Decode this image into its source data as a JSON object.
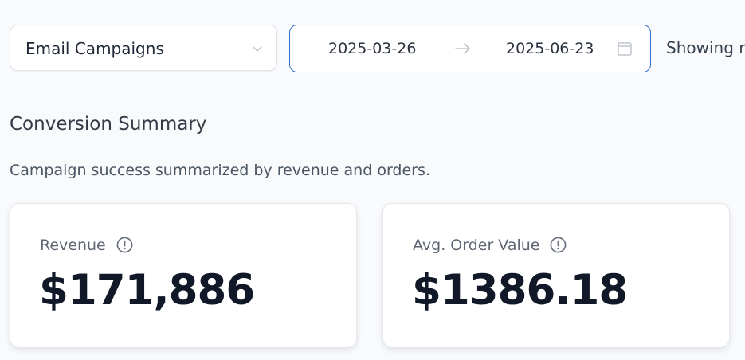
{
  "filters": {
    "campaign_select": {
      "selected": "Email Campaigns",
      "icon": "chevron-down-icon"
    },
    "date_range": {
      "start": "2025-03-26",
      "end": "2025-06-23",
      "separator_icon": "arrow-right-icon",
      "calendar_icon": "calendar-icon",
      "accent_color": "#2f6fc9"
    },
    "showing_text": "Showing r"
  },
  "summary": {
    "title": "Conversion Summary",
    "subtitle": "Campaign success summarized by revenue and orders."
  },
  "metrics": [
    {
      "label": "Revenue",
      "value": "$171,886",
      "icon": "info-circle-icon"
    },
    {
      "label": "Avg. Order Value",
      "value": "$1386.18",
      "icon": "info-circle-icon"
    }
  ]
}
